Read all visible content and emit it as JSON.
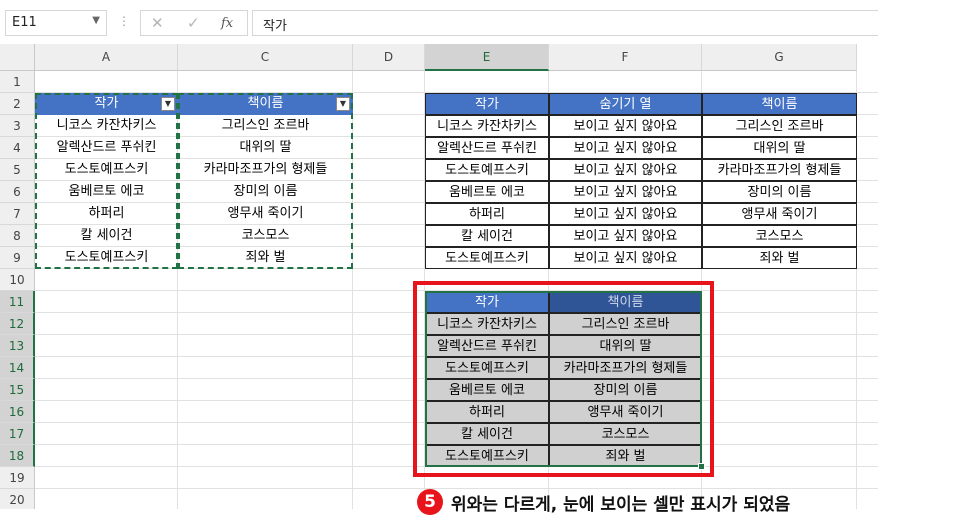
{
  "formula_bar": {
    "name_box": "E11",
    "cancel_icon": "✕",
    "confirm_icon": "✓",
    "function_icon": "fx",
    "content": "작가"
  },
  "columns": [
    "A",
    "C",
    "D",
    "E",
    "F",
    "G"
  ],
  "rows": [
    "1",
    "2",
    "3",
    "4",
    "5",
    "6",
    "7",
    "8",
    "9",
    "10",
    "11",
    "12",
    "13",
    "14",
    "15",
    "16",
    "17",
    "18",
    "19",
    "20"
  ],
  "table1": {
    "headers": [
      "작가",
      "책이름"
    ],
    "rows": [
      [
        "니코스 카잔차키스",
        "그리스인 조르바"
      ],
      [
        "알렉산드르 푸쉬킨",
        "대위의 딸"
      ],
      [
        "도스토예프스키",
        "카라마조프가의 형제들"
      ],
      [
        "움베르토 에코",
        "장미의 이름"
      ],
      [
        "하퍼리",
        "앵무새 죽이기"
      ],
      [
        "칼 세이건",
        "코스모스"
      ],
      [
        "도스토예프스키",
        "죄와 벌"
      ]
    ]
  },
  "table2": {
    "headers": [
      "작가",
      "숨기기 열",
      "책이름"
    ],
    "rows": [
      [
        "니코스 카잔차키스",
        "보이고 싶지 않아요",
        "그리스인 조르바"
      ],
      [
        "알렉산드르 푸쉬킨",
        "보이고 싶지 않아요",
        "대위의 딸"
      ],
      [
        "도스토예프스키",
        "보이고 싶지 않아요",
        "카라마조프가의 형제들"
      ],
      [
        "움베르토 에코",
        "보이고 싶지 않아요",
        "장미의 이름"
      ],
      [
        "하퍼리",
        "보이고 싶지 않아요",
        "앵무새 죽이기"
      ],
      [
        "칼 세이건",
        "보이고 싶지 않아요",
        "코스모스"
      ],
      [
        "도스토예프스키",
        "보이고 싶지 않아요",
        "죄와 벌"
      ]
    ]
  },
  "table3": {
    "headers": [
      "작가",
      "책이름"
    ],
    "rows": [
      [
        "니코스 카잔차키스",
        "그리스인 조르바"
      ],
      [
        "알렉산드르 푸쉬킨",
        "대위의 딸"
      ],
      [
        "도스토예프스키",
        "카라마조프가의 형제들"
      ],
      [
        "움베르토 에코",
        "장미의 이름"
      ],
      [
        "하퍼리",
        "앵무새 죽이기"
      ],
      [
        "칼 세이건",
        "코스모스"
      ],
      [
        "도스토예프스키",
        "죄와 벌"
      ]
    ]
  },
  "annotation": {
    "step": "5",
    "text": "위와는 다르게, 눈에 보이는 셀만 표시가 되었음"
  },
  "colors": {
    "table_header": "#4472c4",
    "selection": "#217346",
    "highlight_frame": "#e8141b",
    "visible_cells_fill": "#d0d0d0"
  }
}
